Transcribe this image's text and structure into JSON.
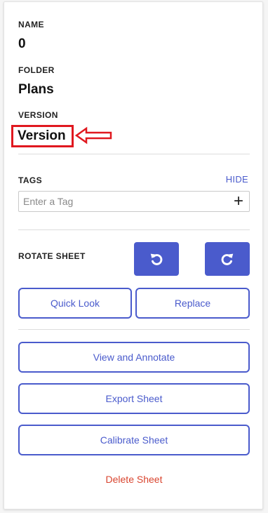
{
  "fields": {
    "name_label": "NAME",
    "name_value": "0",
    "folder_label": "FOLDER",
    "folder_value": "Plans",
    "version_label": "VERSION",
    "version_value": "Version"
  },
  "annotation": {
    "color": "#e0181f"
  },
  "tags": {
    "label": "TAGS",
    "hide_label": "HIDE",
    "input_placeholder": "Enter a Tag",
    "input_value": "",
    "add_icon": "plus-icon"
  },
  "rotate": {
    "label": "ROTATE SHEET",
    "left_icon": "rotate-counterclockwise-icon",
    "right_icon": "rotate-clockwise-icon"
  },
  "actions": {
    "quick_look": "Quick Look",
    "replace": "Replace",
    "view_annotate": "View and Annotate",
    "export": "Export Sheet",
    "calibrate": "Calibrate Sheet",
    "delete": "Delete Sheet"
  },
  "colors": {
    "accent": "#4a5bcc",
    "danger": "#d9452f"
  }
}
